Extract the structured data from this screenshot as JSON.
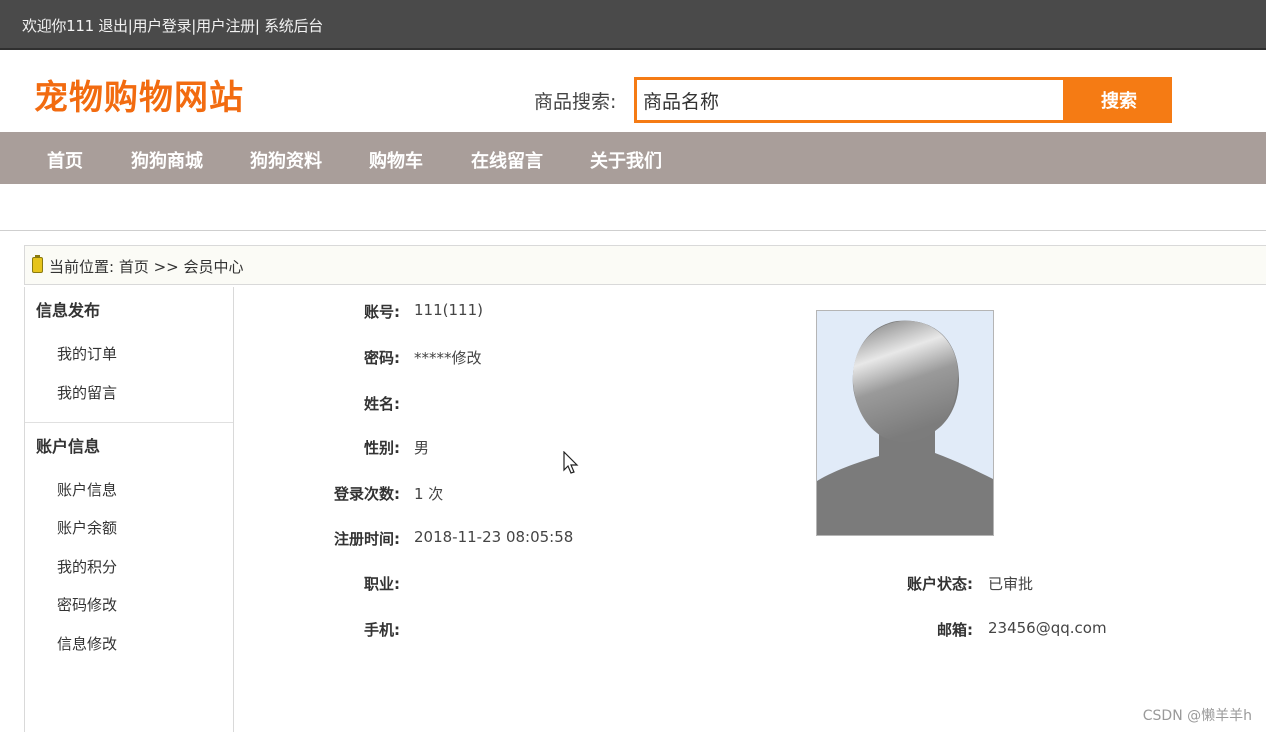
{
  "topbar": {
    "welcome": "欢迎你111",
    "logout": "退出",
    "sep": "|",
    "user_login": "用户登录",
    "user_register": "用户注册",
    "admin": "系统后台"
  },
  "header": {
    "logo": "宠物购物网站",
    "search_label": "商品搜索:",
    "search_value": "商品名称",
    "search_button": "搜索"
  },
  "nav": [
    "首页",
    "狗狗商城",
    "狗狗资料",
    "购物车",
    "在线留言",
    "关于我们"
  ],
  "breadcrumb": "当前位置: 首页 >> 会员中心",
  "sidebar": {
    "section1": {
      "title": "信息发布",
      "items": [
        "我的订单",
        "我的留言"
      ]
    },
    "section2": {
      "title": "账户信息",
      "items": [
        "账户信息",
        "账户余额",
        "我的积分",
        "密码修改",
        "信息修改"
      ]
    }
  },
  "profile": {
    "account_label": "账号:",
    "account_value": "111(111)",
    "password_label": "密码:",
    "password_value": "*****",
    "password_modify": "修改",
    "name_label": "姓名:",
    "name_value": "",
    "gender_label": "性别:",
    "gender_value": "男",
    "login_count_label": "登录次数:",
    "login_count_value": "1 次",
    "register_time_label": "注册时间:",
    "register_time_value": "2018-11-23 08:05:58",
    "job_label": "职业:",
    "job_value": "",
    "phone_label": "手机:",
    "phone_value": "",
    "status_label": "账户状态:",
    "status_value": "已审批",
    "email_label": "邮箱:",
    "email_value": "23456@qq.com"
  },
  "watermark": "CSDN @懒羊羊h",
  "colors": {
    "brand_orange": "#f26b10",
    "nav_bg": "#a99e9a",
    "topbar_bg": "#4a4a4a"
  },
  "icons": {
    "breadcrumb": "location-icon",
    "avatar": "user-avatar-placeholder",
    "pointer": "mouse-cursor-icon"
  }
}
